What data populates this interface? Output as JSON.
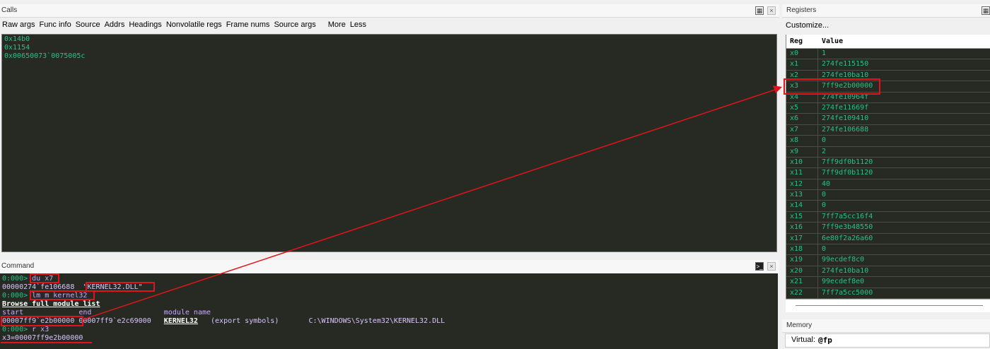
{
  "calls": {
    "title": "Calls",
    "toolbar": [
      "Raw args",
      "Func info",
      "Source",
      "Addrs",
      "Headings",
      "Nonvolatile regs",
      "Frame nums",
      "Source args",
      "More",
      "Less"
    ],
    "lines": [
      "0x14b0",
      "0x1154",
      "0x00650073`0075005c"
    ]
  },
  "command": {
    "title": "Command",
    "lines": [
      {
        "prompt": "0:000>",
        "input": " du x7"
      },
      {
        "out": "00000274`fe106688  \"KERNEL32.DLL\""
      },
      {
        "prompt": "0:000>",
        "input": " lm m kernel32"
      },
      {
        "link": "Browse full module list"
      },
      {
        "head": "start             end                 module name"
      },
      {
        "out": "00007ff9`e2b00000 00007ff9`e2c69000   ",
        "mod": "KERNEL32",
        "rest": "   (export symbols)       C:\\WINDOWS\\System32\\KERNEL32.DLL"
      },
      {
        "prompt": "0:000>",
        "input": " r x3"
      },
      {
        "out": "x3=00007ff9e2b00000"
      }
    ]
  },
  "registers": {
    "title": "Registers",
    "customize": "Customize...",
    "col_reg": "Reg",
    "col_value": "Value",
    "rows": [
      {
        "reg": "x0",
        "value": "1"
      },
      {
        "reg": "x1",
        "value": "274fe115150"
      },
      {
        "reg": "x2",
        "value": "274fe10ba10"
      },
      {
        "reg": "x3",
        "value": "7ff9e2b00000"
      },
      {
        "reg": "x4",
        "value": "274fe10964f"
      },
      {
        "reg": "x5",
        "value": "274fe11669f"
      },
      {
        "reg": "x6",
        "value": "274fe109410"
      },
      {
        "reg": "x7",
        "value": "274fe106688"
      },
      {
        "reg": "x8",
        "value": "0"
      },
      {
        "reg": "x9",
        "value": "2"
      },
      {
        "reg": "x10",
        "value": "7ff9df0b1120"
      },
      {
        "reg": "x11",
        "value": "7ff9df0b1120"
      },
      {
        "reg": "x12",
        "value": "40"
      },
      {
        "reg": "x13",
        "value": "0"
      },
      {
        "reg": "x14",
        "value": "0"
      },
      {
        "reg": "x15",
        "value": "7ff7a5cc16f4"
      },
      {
        "reg": "x16",
        "value": "7ff9e3b48550"
      },
      {
        "reg": "x17",
        "value": "6e80f2a26a60"
      },
      {
        "reg": "x18",
        "value": "0"
      },
      {
        "reg": "x19",
        "value": "99ecdef8c0"
      },
      {
        "reg": "x20",
        "value": "274fe10ba10"
      },
      {
        "reg": "x21",
        "value": "99ecdef8e0"
      },
      {
        "reg": "x22",
        "value": "7ff7a5cc5000"
      }
    ]
  },
  "memory": {
    "title": "Memory",
    "virtual_label": "Virtual:",
    "virtual_value": "@fp"
  },
  "colors": {
    "console_bg": "#272a22",
    "console_text": "#22c48a",
    "highlight": "#e0141a"
  }
}
